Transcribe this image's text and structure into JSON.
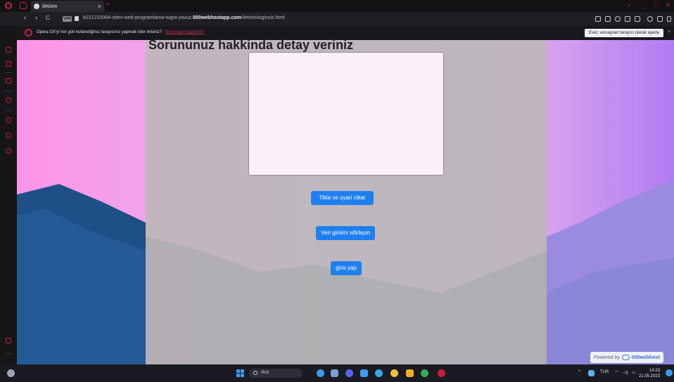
{
  "browser": {
    "tab_title": "iletisim",
    "tab_close": "×",
    "new_tab": "+",
    "url_prefix": "b221210064-odev-web-programlama-tugra-yavuz.",
    "url_domain": "000webhostapp.com",
    "url_path": "/iletisimloginsiz.html",
    "vpn_label": "VPN",
    "nav_back": "‹",
    "nav_forward": "›",
    "nav_reload": "C"
  },
  "infobar": {
    "message": "Opera GX'yi her gün kullandığınız tarayıcınız yapmak ister misiniz?",
    "link": "Bunu nasıl yaparım?",
    "button": "Evet, varsayılan tarayıcı olarak ayarla",
    "close": "×"
  },
  "page": {
    "title": "Sorununuz hakkinda detay veriniz",
    "textarea_value": "",
    "buttons": {
      "alert": "Tikla ve uyari cikar",
      "reset": "Veri girisini sifirlayin",
      "login": "giris yap"
    },
    "powered_by": "Powered by",
    "powered_brand": "000webhost"
  },
  "taskbar": {
    "search_placeholder": "Ara",
    "lang": "TUR",
    "time": "14:23",
    "date": "21.05.2023"
  },
  "colors": {
    "button_blue": "#1f7ff0",
    "opera_red": "#c81e3c"
  }
}
